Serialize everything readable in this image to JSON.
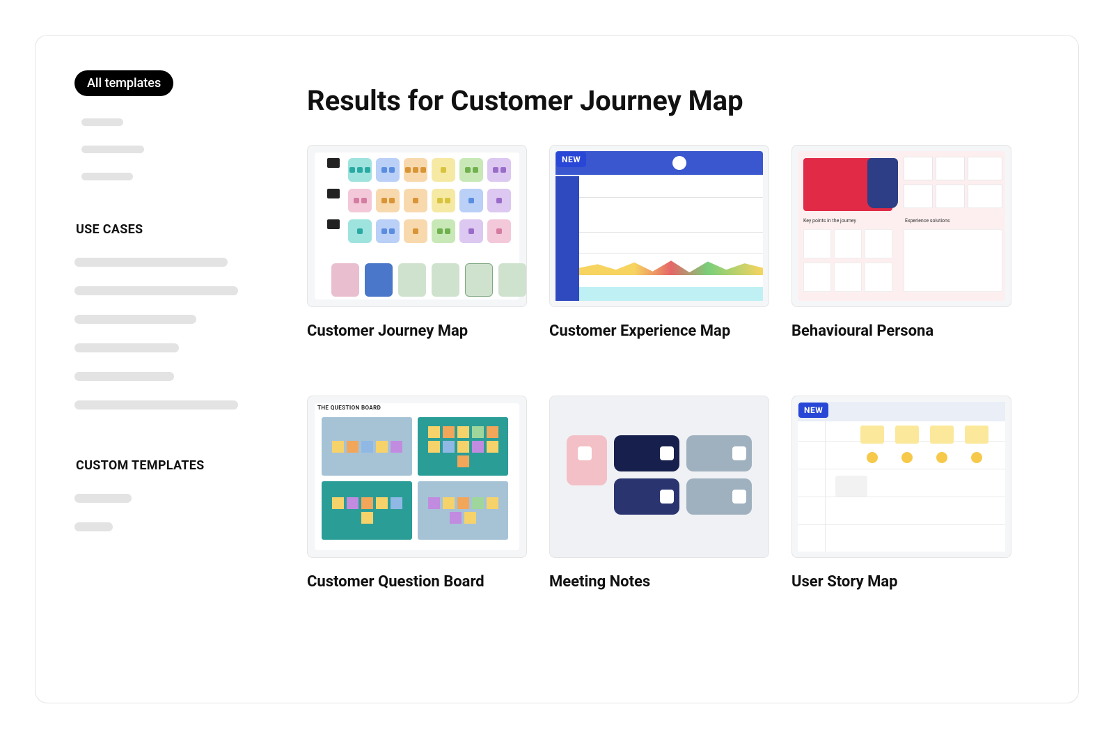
{
  "sidebar": {
    "all_templates_label": "All templates",
    "use_cases_heading": "USE CASES",
    "custom_templates_heading": "CUSTOM TEMPLATES"
  },
  "main": {
    "page_title": "Results for Customer Journey Map",
    "new_badge_label": "NEW",
    "cards": [
      {
        "title": "Customer Journey Map",
        "is_new": false
      },
      {
        "title": "Customer Experience Map",
        "is_new": true
      },
      {
        "title": "Behavioural Persona",
        "is_new": false
      },
      {
        "title": "Customer Question Board",
        "is_new": false
      },
      {
        "title": "Meeting Notes",
        "is_new": false
      },
      {
        "title": "User Story Map",
        "is_new": true
      }
    ]
  },
  "thumb_text": {
    "bp_keypoints": "Key points in the journey",
    "bp_solutions": "Experience solutions",
    "cqb_header": "THE QUESTION BOARD"
  }
}
